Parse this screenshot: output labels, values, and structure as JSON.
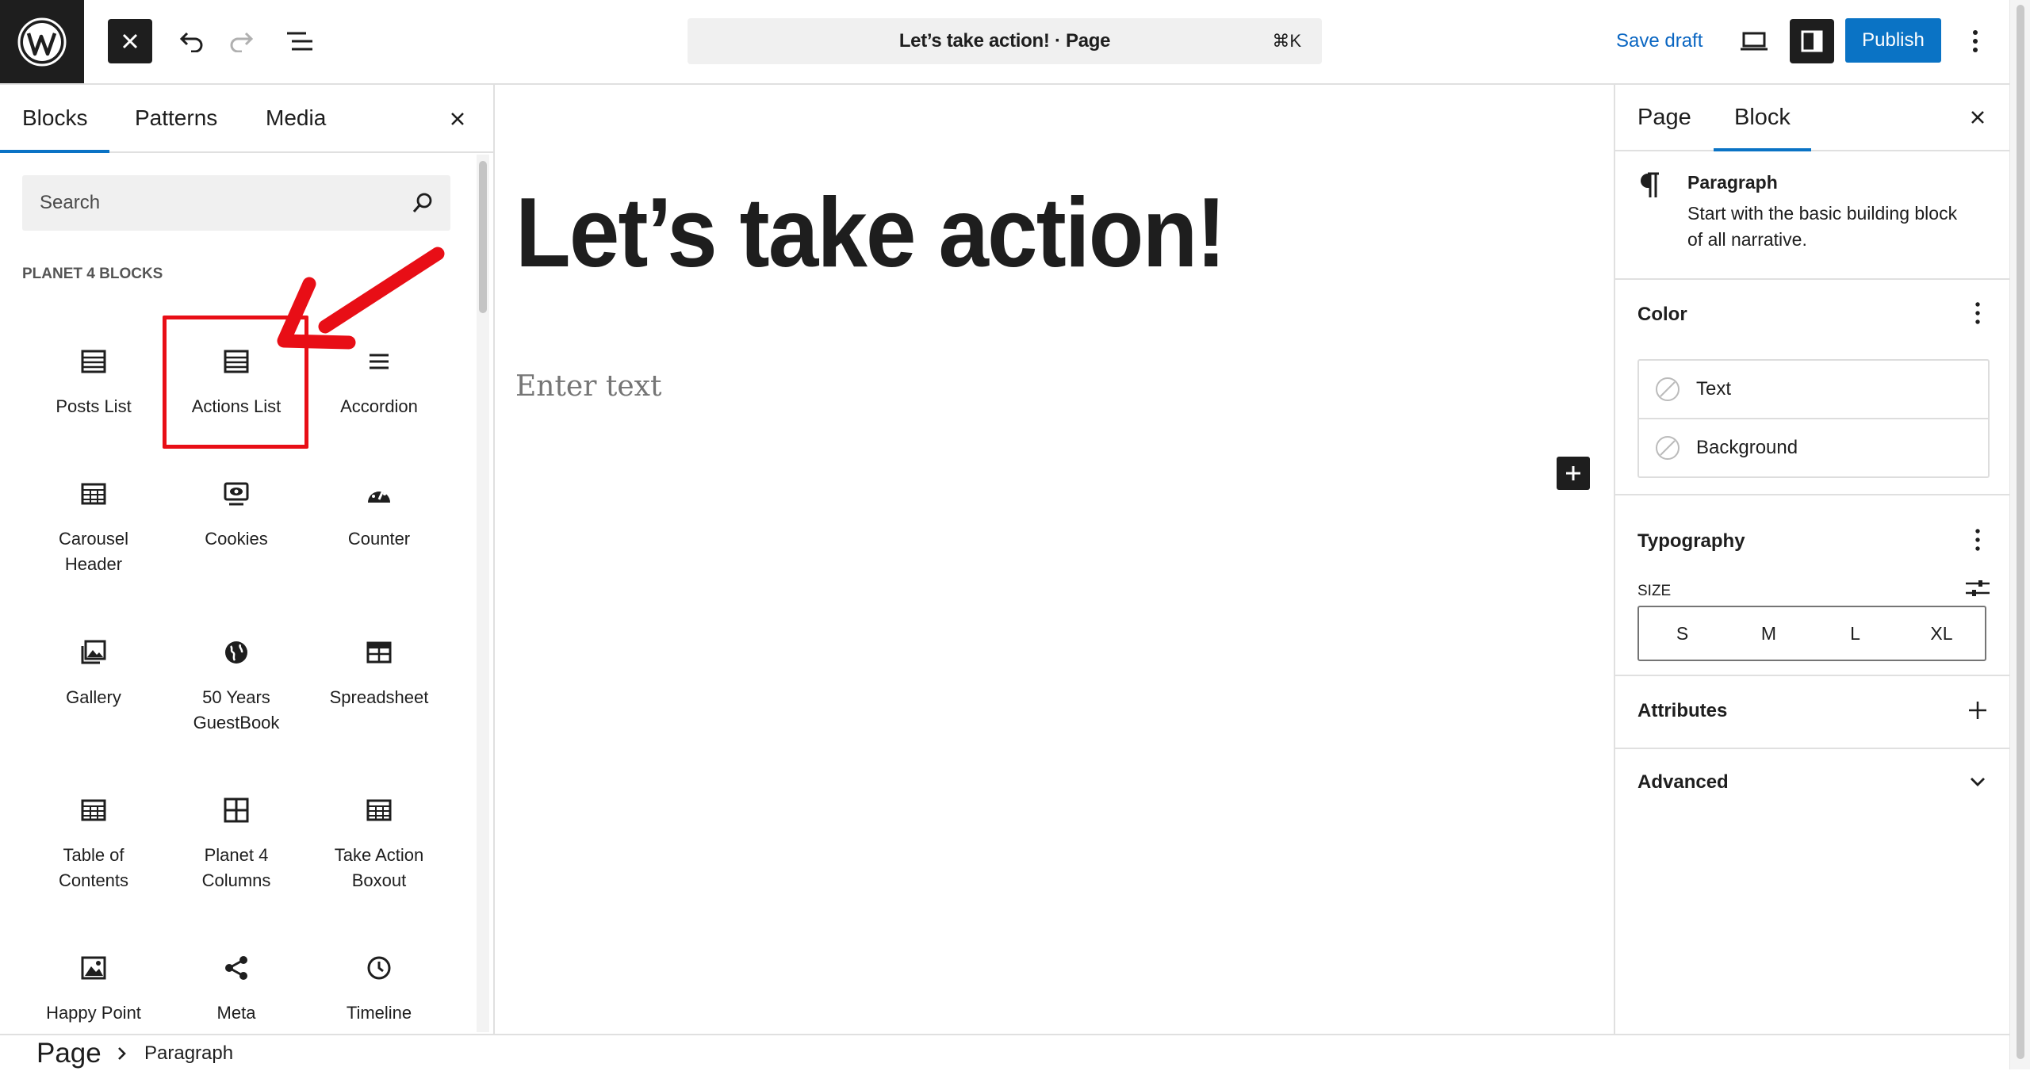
{
  "topbar": {
    "document_title": "Let’s take action! · Page",
    "shortcut": "⌘K",
    "save_draft": "Save draft",
    "publish": "Publish"
  },
  "inserter": {
    "tabs": [
      "Blocks",
      "Patterns",
      "Media"
    ],
    "search_placeholder": "Search",
    "category": "PLANET 4 BLOCKS",
    "blocks": [
      {
        "label": "Posts List",
        "icon": "list-view-icon"
      },
      {
        "label": "Actions List",
        "icon": "list-view-icon"
      },
      {
        "label": "Accordion",
        "icon": "menu-lines-icon"
      },
      {
        "label": "Carousel\nHeader",
        "icon": "table-icon"
      },
      {
        "label": "Cookies",
        "icon": "eye-screen-icon"
      },
      {
        "label": "Counter",
        "icon": "gauge-icon"
      },
      {
        "label": "Gallery",
        "icon": "gallery-icon"
      },
      {
        "label": "50 Years\nGuestBook",
        "icon": "globe-icon"
      },
      {
        "label": "Spreadsheet",
        "icon": "spreadsheet-icon"
      },
      {
        "label": "Table of\nContents",
        "icon": "table-icon"
      },
      {
        "label": "Planet 4\nColumns",
        "icon": "columns-icon"
      },
      {
        "label": "Take Action\nBoxout",
        "icon": "table-icon"
      },
      {
        "label": "Happy Point",
        "icon": "image-icon"
      },
      {
        "label": "Meta",
        "icon": "share-icon"
      },
      {
        "label": "Timeline",
        "icon": "clock-icon"
      }
    ]
  },
  "canvas": {
    "title": "Let’s take action!",
    "paragraph_placeholder": "Enter text"
  },
  "sidebar": {
    "tabs": [
      "Page",
      "Block"
    ],
    "block_name": "Paragraph",
    "block_description_1": "Start with the basic building block",
    "block_description_2": "of all narrative.",
    "color_title": "Color",
    "color_items": [
      "Text",
      "Background"
    ],
    "typography_title": "Typography",
    "size_label": "SIZE",
    "sizes": [
      "S",
      "M",
      "L",
      "XL"
    ],
    "attributes_title": "Attributes",
    "advanced_title": "Advanced"
  },
  "footer": {
    "root": "Page",
    "current": "Paragraph"
  },
  "colors": {
    "accent": "#0a73c5",
    "highlight": "#e80e16",
    "dark": "#1e1e1e"
  }
}
